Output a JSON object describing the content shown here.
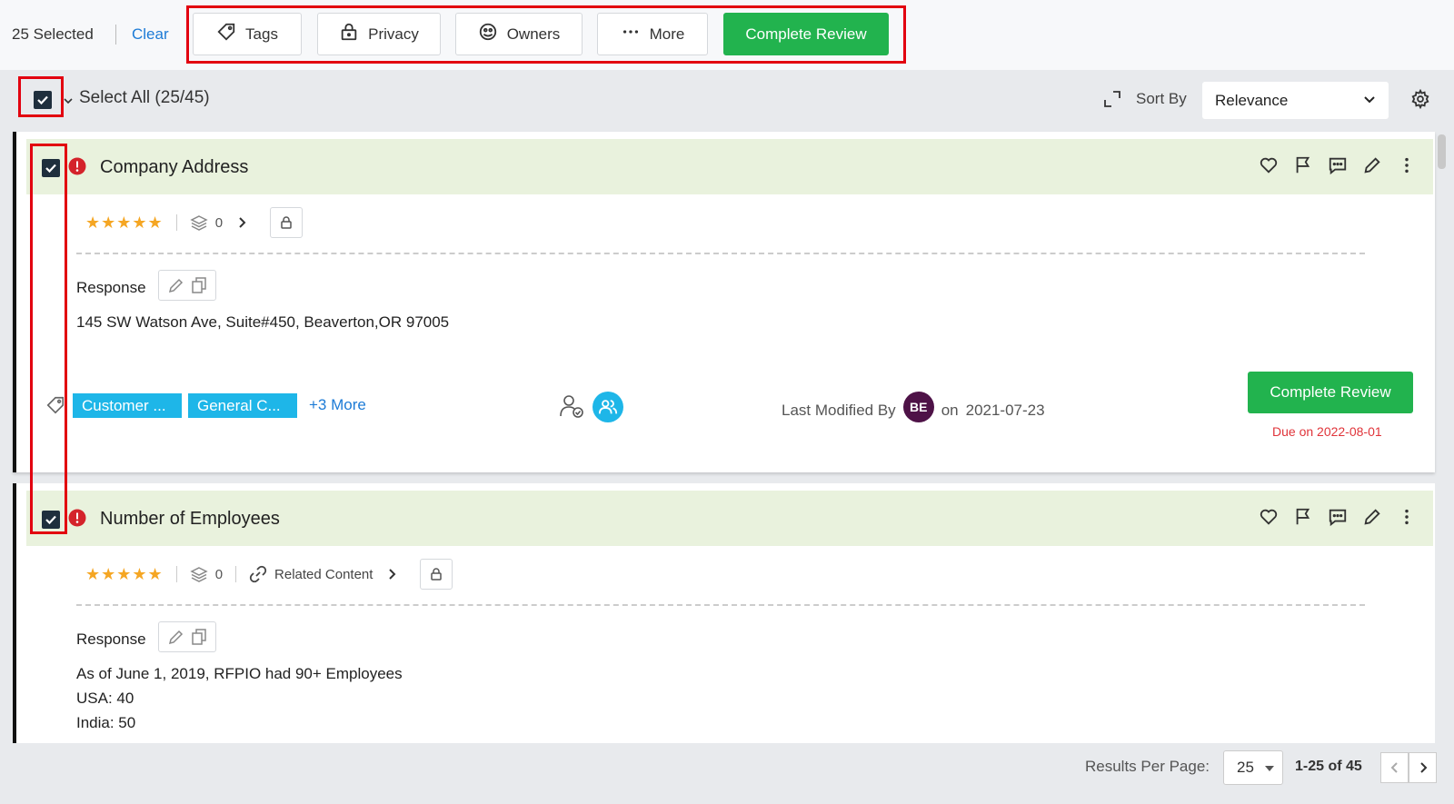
{
  "topbar": {
    "selected_text": "25 Selected",
    "clear_label": "Clear",
    "tags_label": "Tags",
    "privacy_label": "Privacy",
    "owners_label": "Owners",
    "more_label": "More",
    "complete_review_label": "Complete Review"
  },
  "listbar": {
    "select_all_label": "Select All (25/45)",
    "sort_by_label": "Sort By",
    "sort_value": "Relevance"
  },
  "cards": [
    {
      "title": "Company Address",
      "stars": "★★★★★",
      "layer_count": "0",
      "response_label": "Response",
      "response_lines": [
        "145 SW Watson Ave, Suite#450, Beaverton,OR 97005"
      ],
      "tags": [
        "Customer ...",
        "General C..."
      ],
      "more_tags": "+3 More",
      "last_modified_label": "Last Modified By",
      "avatar_initials": "BE",
      "on_label": "on",
      "modified_date": "2021-07-23",
      "review_label": "Complete Review",
      "due_text": "Due on 2022-08-01"
    },
    {
      "title": "Number of Employees",
      "stars": "★★★★★",
      "layer_count": "0",
      "related_label": "Related Content",
      "response_label": "Response",
      "response_lines": [
        "As of June 1, 2019, RFPIO had 90+ Employees",
        "USA: 40",
        "India: 50"
      ]
    }
  ],
  "footer": {
    "results_per_page_label": "Results Per Page:",
    "per_page_value": "25",
    "range_text": "1-25 of 45"
  },
  "colors": {
    "accent_green": "#22b34e",
    "link_blue": "#1d7bd6",
    "tag_cyan": "#1eb6e8",
    "highlight_red": "#e2000f",
    "due_red": "#e0343a"
  }
}
